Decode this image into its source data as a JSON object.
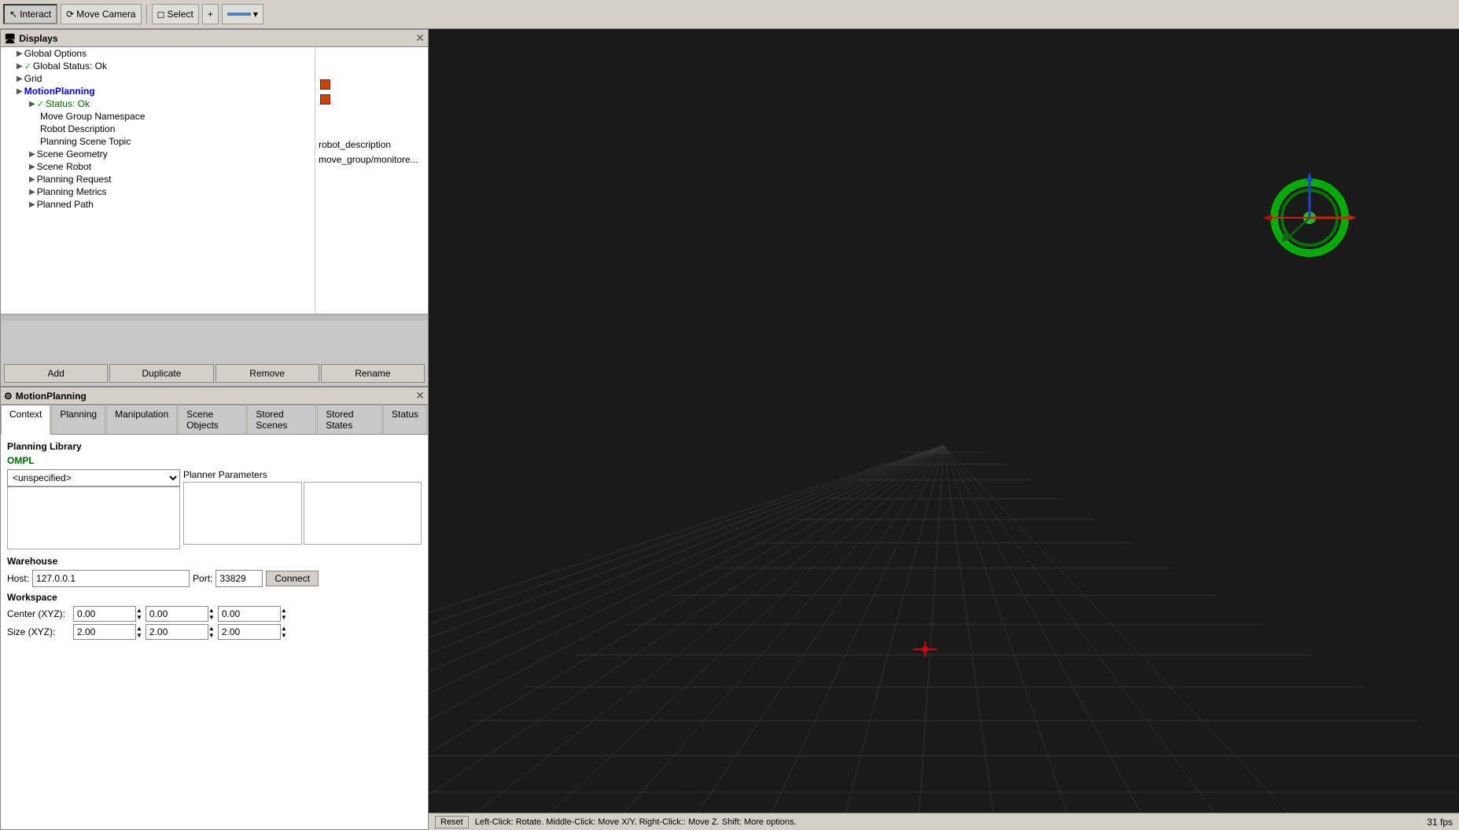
{
  "toolbar": {
    "interact_label": "Interact",
    "move_camera_label": "Move Camera",
    "select_label": "Select",
    "plus_label": "+",
    "arrow_label": "▾"
  },
  "displays_panel": {
    "title": "Displays",
    "items": [
      {
        "level": 1,
        "arrow": "▶",
        "check": "",
        "label": "Global Options",
        "value": ""
      },
      {
        "level": 1,
        "arrow": "▶",
        "check": "✓",
        "label": "Global Status: Ok",
        "value": "",
        "checked": true
      },
      {
        "level": 1,
        "arrow": "▶",
        "check": "",
        "label": "Grid",
        "value": "",
        "is_blue": false,
        "is_checked_orange": true
      },
      {
        "level": 1,
        "arrow": "▶",
        "check": "",
        "label": "MotionPlanning",
        "value": "",
        "is_blue": true,
        "is_checked_orange": true
      },
      {
        "level": 2,
        "arrow": "▶",
        "check": "✓",
        "label": "Status: Ok",
        "value": "",
        "is_green": true
      },
      {
        "level": 2,
        "arrow": "",
        "check": "",
        "label": "Move Group Namespace",
        "value": ""
      },
      {
        "level": 2,
        "arrow": "",
        "check": "",
        "label": "Robot Description",
        "value": "robot_description"
      },
      {
        "level": 2,
        "arrow": "",
        "check": "",
        "label": "Planning Scene Topic",
        "value": "move_group/monitore..."
      },
      {
        "level": 2,
        "arrow": "▶",
        "check": "",
        "label": "Scene Geometry",
        "value": ""
      },
      {
        "level": 2,
        "arrow": "▶",
        "check": "",
        "label": "Scene Robot",
        "value": ""
      },
      {
        "level": 2,
        "arrow": "▶",
        "check": "",
        "label": "Planning Request",
        "value": ""
      },
      {
        "level": 2,
        "arrow": "▶",
        "check": "",
        "label": "Planning Metrics",
        "value": ""
      },
      {
        "level": 2,
        "arrow": "▶",
        "check": "",
        "label": "Planned Path",
        "value": ""
      }
    ]
  },
  "buttons": {
    "add": "Add",
    "duplicate": "Duplicate",
    "remove": "Remove",
    "rename": "Rename"
  },
  "motion_panel": {
    "title": "MotionPlanning",
    "tabs": [
      "Context",
      "Planning",
      "Manipulation",
      "Scene Objects",
      "Stored Scenes",
      "Stored States",
      "Status"
    ],
    "active_tab": "Context"
  },
  "context_tab": {
    "planning_library_label": "Planning Library",
    "ompl_label": "OMPL",
    "planner_params_label": "Planner Parameters",
    "planner_select": "<unspecified>",
    "warehouse_label": "Warehouse",
    "host_label": "Host:",
    "host_value": "127.0.0.1",
    "port_label": "Port:",
    "port_value": "33829",
    "connect_label": "Connect",
    "workspace_label": "Workspace",
    "center_xyz_label": "Center (XYZ):",
    "center_x": "0.00",
    "center_y": "0.00",
    "center_z": "0.00",
    "size_xyz_label": "Size (XYZ):",
    "size_x": "2.00",
    "size_y": "2.00",
    "size_z": "2.00"
  },
  "status_bar": {
    "reset_label": "Reset",
    "hint": "Left-Click: Rotate.  Middle-Click: Move X/Y.  Right-Click:: Move Z.  Shift: More options.",
    "fps": "31 fps"
  },
  "colors": {
    "viewport_bg": "#1a1a1a",
    "grid_line": "#3a3a3a",
    "accent_green": "#00cc00",
    "accent_blue": "#0000cc",
    "accent_red": "#cc0000"
  }
}
